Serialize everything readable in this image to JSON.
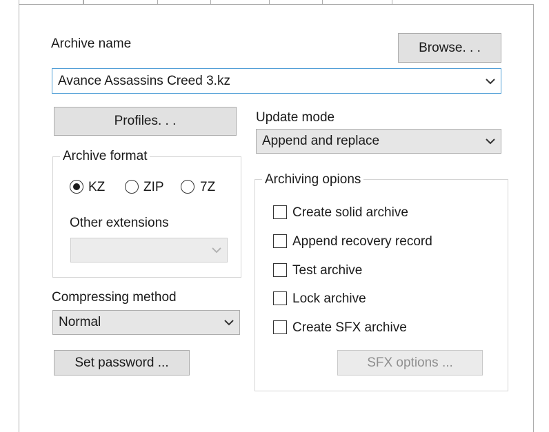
{
  "archive_name": {
    "label": "Archive name",
    "value": "Avance Assassins Creed 3.kz",
    "browse_label": "Browse. . ."
  },
  "profiles_label": "Profiles. . .",
  "archive_format": {
    "title": "Archive format",
    "options": [
      {
        "label": "KZ",
        "selected": true
      },
      {
        "label": "ZIP",
        "selected": false
      },
      {
        "label": "7Z",
        "selected": false
      }
    ],
    "other_extensions_label": "Other extensions",
    "other_extensions_value": ""
  },
  "compression": {
    "label": "Compressing method",
    "value": "Normal"
  },
  "set_password_label": "Set password ...",
  "update_mode": {
    "label": "Update mode",
    "value": "Append and replace"
  },
  "archiving_options": {
    "title": "Archiving opions",
    "items": [
      {
        "label": "Create solid archive",
        "checked": false
      },
      {
        "label": "Append recovery record",
        "checked": false
      },
      {
        "label": "Test archive",
        "checked": false
      },
      {
        "label": "Lock archive",
        "checked": false
      },
      {
        "label": "Create SFX archive",
        "checked": false
      }
    ],
    "sfx_options_label": "SFX options ..."
  },
  "icons": {
    "dropdown": "chevron-down-icon"
  }
}
